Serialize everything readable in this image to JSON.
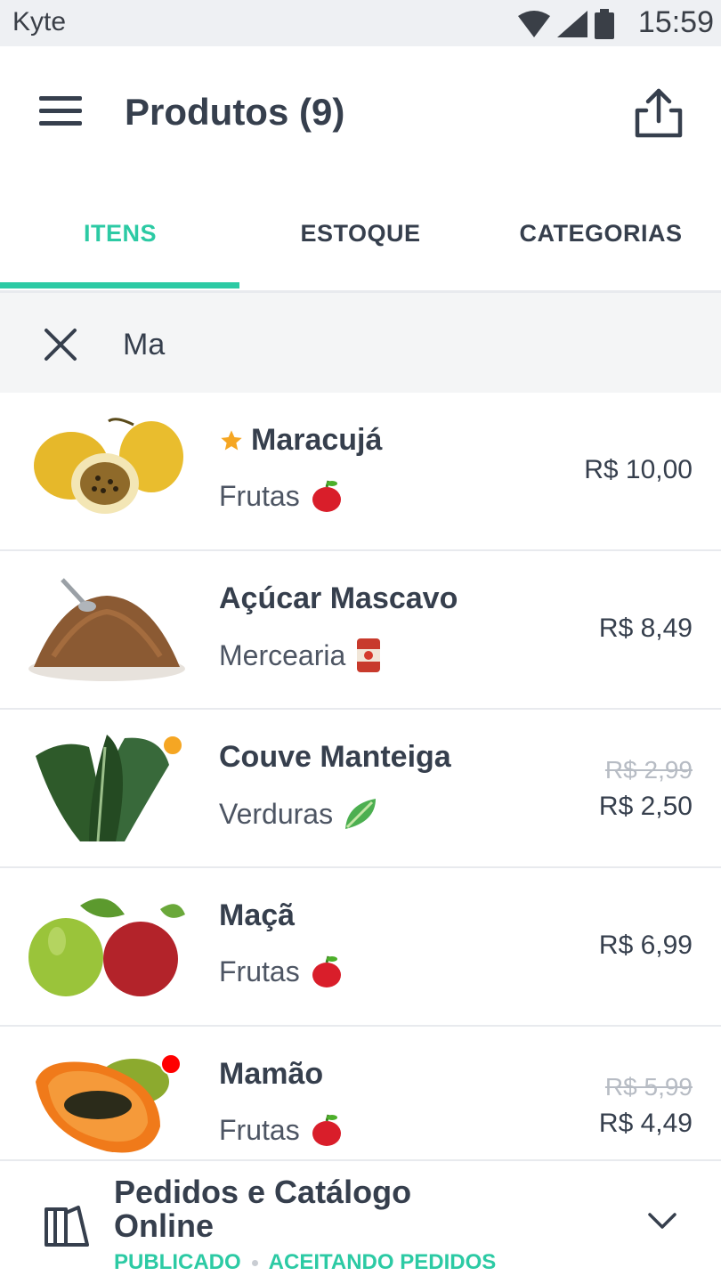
{
  "status_bar": {
    "app_label": "Kyte",
    "time": "15:59"
  },
  "header": {
    "title": "Produtos (9)"
  },
  "tabs": [
    {
      "label": "ITENS",
      "active": true
    },
    {
      "label": "ESTOQUE",
      "active": false
    },
    {
      "label": "CATEGORIAS",
      "active": false
    }
  ],
  "search": {
    "value": "Ma",
    "placeholder": ""
  },
  "products": [
    {
      "name": "Maracujá",
      "favorite": true,
      "category": "Frutas",
      "category_icon": "apple-icon",
      "price": "R$ 10,00",
      "old_price": ""
    },
    {
      "name": "Açúcar Mascavo",
      "favorite": false,
      "category": "Mercearia",
      "category_icon": "can-icon",
      "price": "R$ 8,49",
      "old_price": ""
    },
    {
      "name": "Couve Manteiga",
      "favorite": false,
      "category": "Verduras",
      "category_icon": "lettuce-icon",
      "price": "R$ 2,50",
      "old_price": "R$ 2,99",
      "stock_status": "low",
      "stock_color": "#f5a623"
    },
    {
      "name": "Maçã",
      "favorite": false,
      "category": "Frutas",
      "category_icon": "apple-icon",
      "price": "R$ 6,99",
      "old_price": ""
    },
    {
      "name": "Mamão",
      "favorite": false,
      "category": "Frutas",
      "category_icon": "apple-icon",
      "price": "R$ 4,49",
      "old_price": "R$ 5,99",
      "stock_status": "out",
      "stock_color": "#ff0000"
    }
  ],
  "bottom_panel": {
    "title": "Pedidos e Catálogo Online",
    "status_published": "PUBLICADO",
    "status_orders": "ACEITANDO PEDIDOS"
  },
  "colors": {
    "accent": "#2ccaa4",
    "text": "#363f4d",
    "favorite_star": "#f5a623"
  }
}
